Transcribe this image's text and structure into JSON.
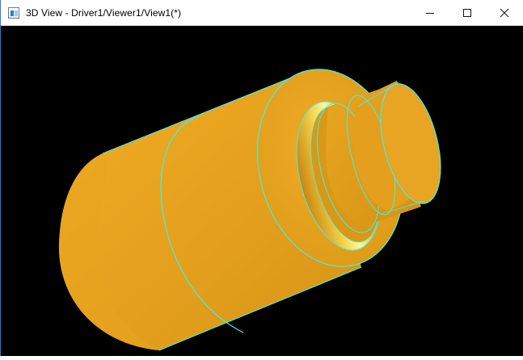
{
  "window": {
    "title": "3D View - Driver1/Viewer1/View1(*)",
    "controls": [
      "minimize",
      "maximize",
      "close"
    ]
  },
  "viewport": {
    "background": "#000000",
    "model": "cylindrical stepped part",
    "face_color": "#e6a21e",
    "edge_color": "#3ef0e8"
  }
}
